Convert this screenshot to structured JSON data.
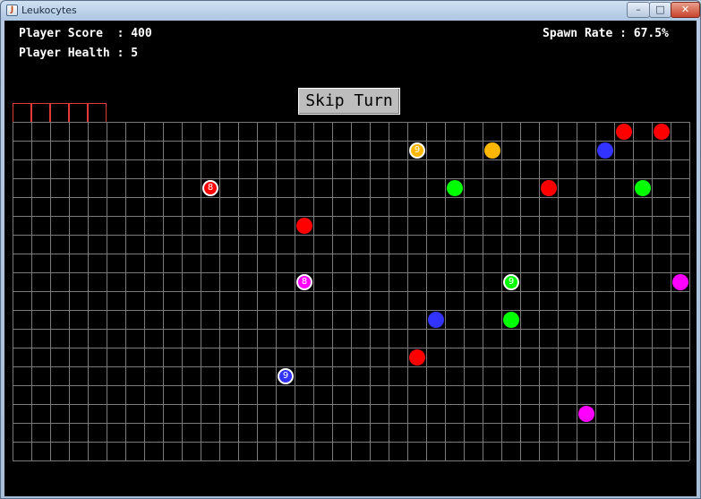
{
  "window": {
    "title": "Leukocytes"
  },
  "hud": {
    "score_label": "Player Score  : 400",
    "health_label": "Player Health : 5",
    "spawn_label": "Spawn Rate : 67.5%"
  },
  "controls": {
    "skip_label": "Skip Turn"
  },
  "board": {
    "cols": 36,
    "rows": 18,
    "grid_color": "#7a7a7a",
    "spawn_zone_color": "#e03a3a",
    "spawn_cells": 5,
    "pieces": [
      {
        "col": 32,
        "row": 0,
        "color": "#ff0000"
      },
      {
        "col": 34,
        "row": 0,
        "color": "#ff0000"
      },
      {
        "col": 21,
        "row": 1,
        "color": "#ffb700",
        "label": "9"
      },
      {
        "col": 25,
        "row": 1,
        "color": "#ffb700"
      },
      {
        "col": 31,
        "row": 1,
        "color": "#3333ff"
      },
      {
        "col": 10,
        "row": 3,
        "color": "#ff0000",
        "label": "8"
      },
      {
        "col": 23,
        "row": 3,
        "color": "#00ff00"
      },
      {
        "col": 28,
        "row": 3,
        "color": "#ff0000"
      },
      {
        "col": 33,
        "row": 3,
        "color": "#00ff00"
      },
      {
        "col": 15,
        "row": 5,
        "color": "#ff0000"
      },
      {
        "col": 15,
        "row": 8,
        "color": "#ff00ff",
        "label": "8"
      },
      {
        "col": 26,
        "row": 8,
        "color": "#00ff00",
        "label": "9"
      },
      {
        "col": 35,
        "row": 8,
        "color": "#ff00ff"
      },
      {
        "col": 22,
        "row": 10,
        "color": "#3333ff"
      },
      {
        "col": 26,
        "row": 10,
        "color": "#00ff00"
      },
      {
        "col": 21,
        "row": 12,
        "color": "#ff0000"
      },
      {
        "col": 14,
        "row": 13,
        "color": "#3333ff",
        "label": "9"
      },
      {
        "col": 30,
        "row": 15,
        "color": "#ff00ff"
      }
    ]
  }
}
